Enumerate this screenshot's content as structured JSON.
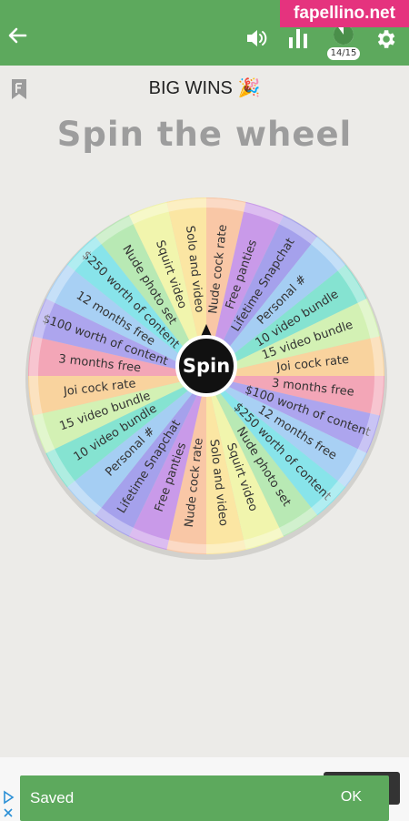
{
  "header": {
    "back_icon": "arrow-left-icon",
    "sound_icon": "speaker-icon",
    "stats_icon": "bar-chart-icon",
    "progress_label": "14/15",
    "progress_fraction": 0.93,
    "settings_icon": "gear-icon",
    "bar_color": "#5da95d"
  },
  "watermark": "fapellino.net",
  "page": {
    "subtitle": "BIG WINS 🎉",
    "title": "Spin the wheel",
    "bookmark_icon": "bookmark-f-icon"
  },
  "wheel": {
    "spin_label": "Spin",
    "segments": [
      {
        "label": "Nude cock rate",
        "color": "#f9c7a6"
      },
      {
        "label": "Free panties",
        "color": "#c99ae9"
      },
      {
        "label": "Lifetime Snapchat",
        "color": "#a5a1ec"
      },
      {
        "label": "Personal #",
        "color": "#a5cef3"
      },
      {
        "label": "10 video bundle",
        "color": "#85e3d1"
      },
      {
        "label": "15 video bundle",
        "color": "#d3f1b4"
      },
      {
        "label": "Joi cock rate",
        "color": "#f9d39e"
      },
      {
        "label": "3 months free",
        "color": "#f3a6b7"
      },
      {
        "label": "$100 worth of content",
        "color": "#ada5ee"
      },
      {
        "label": "12 months free",
        "color": "#a8d0f4"
      },
      {
        "label": "$250 worth of content",
        "color": "#88e4ea"
      },
      {
        "label": "Nude photo set",
        "color": "#b8e9b4"
      },
      {
        "label": "Squirt video",
        "color": "#f1f5ad"
      },
      {
        "label": "Solo and video",
        "color": "#fbe6a3"
      },
      {
        "label": "Nude cock rate",
        "color": "#f9c7a6"
      },
      {
        "label": "Free panties",
        "color": "#c99ae9"
      },
      {
        "label": "Lifetime Snapchat",
        "color": "#a5a1ec"
      },
      {
        "label": "Personal #",
        "color": "#a5cef3"
      },
      {
        "label": "10 video bundle",
        "color": "#85e3d1"
      },
      {
        "label": "15 video bundle",
        "color": "#d3f1b4"
      },
      {
        "label": "Joi cock rate",
        "color": "#f9d39e"
      },
      {
        "label": "3 months free",
        "color": "#f3a6b7"
      },
      {
        "label": "$100 worth of content",
        "color": "#ada5ee"
      },
      {
        "label": "12 months free",
        "color": "#a8d0f4"
      },
      {
        "label": "$250 worth of content",
        "color": "#88e4ea"
      },
      {
        "label": "Nude photo set",
        "color": "#b8e9b4"
      },
      {
        "label": "Squirt video",
        "color": "#f1f5ad"
      },
      {
        "label": "Solo and video",
        "color": "#fbe6a3"
      }
    ]
  },
  "snackbar": {
    "message": "Saved",
    "action": "OK"
  },
  "ad": {
    "icons": [
      "ad-choices-icon",
      "close-icon"
    ]
  }
}
